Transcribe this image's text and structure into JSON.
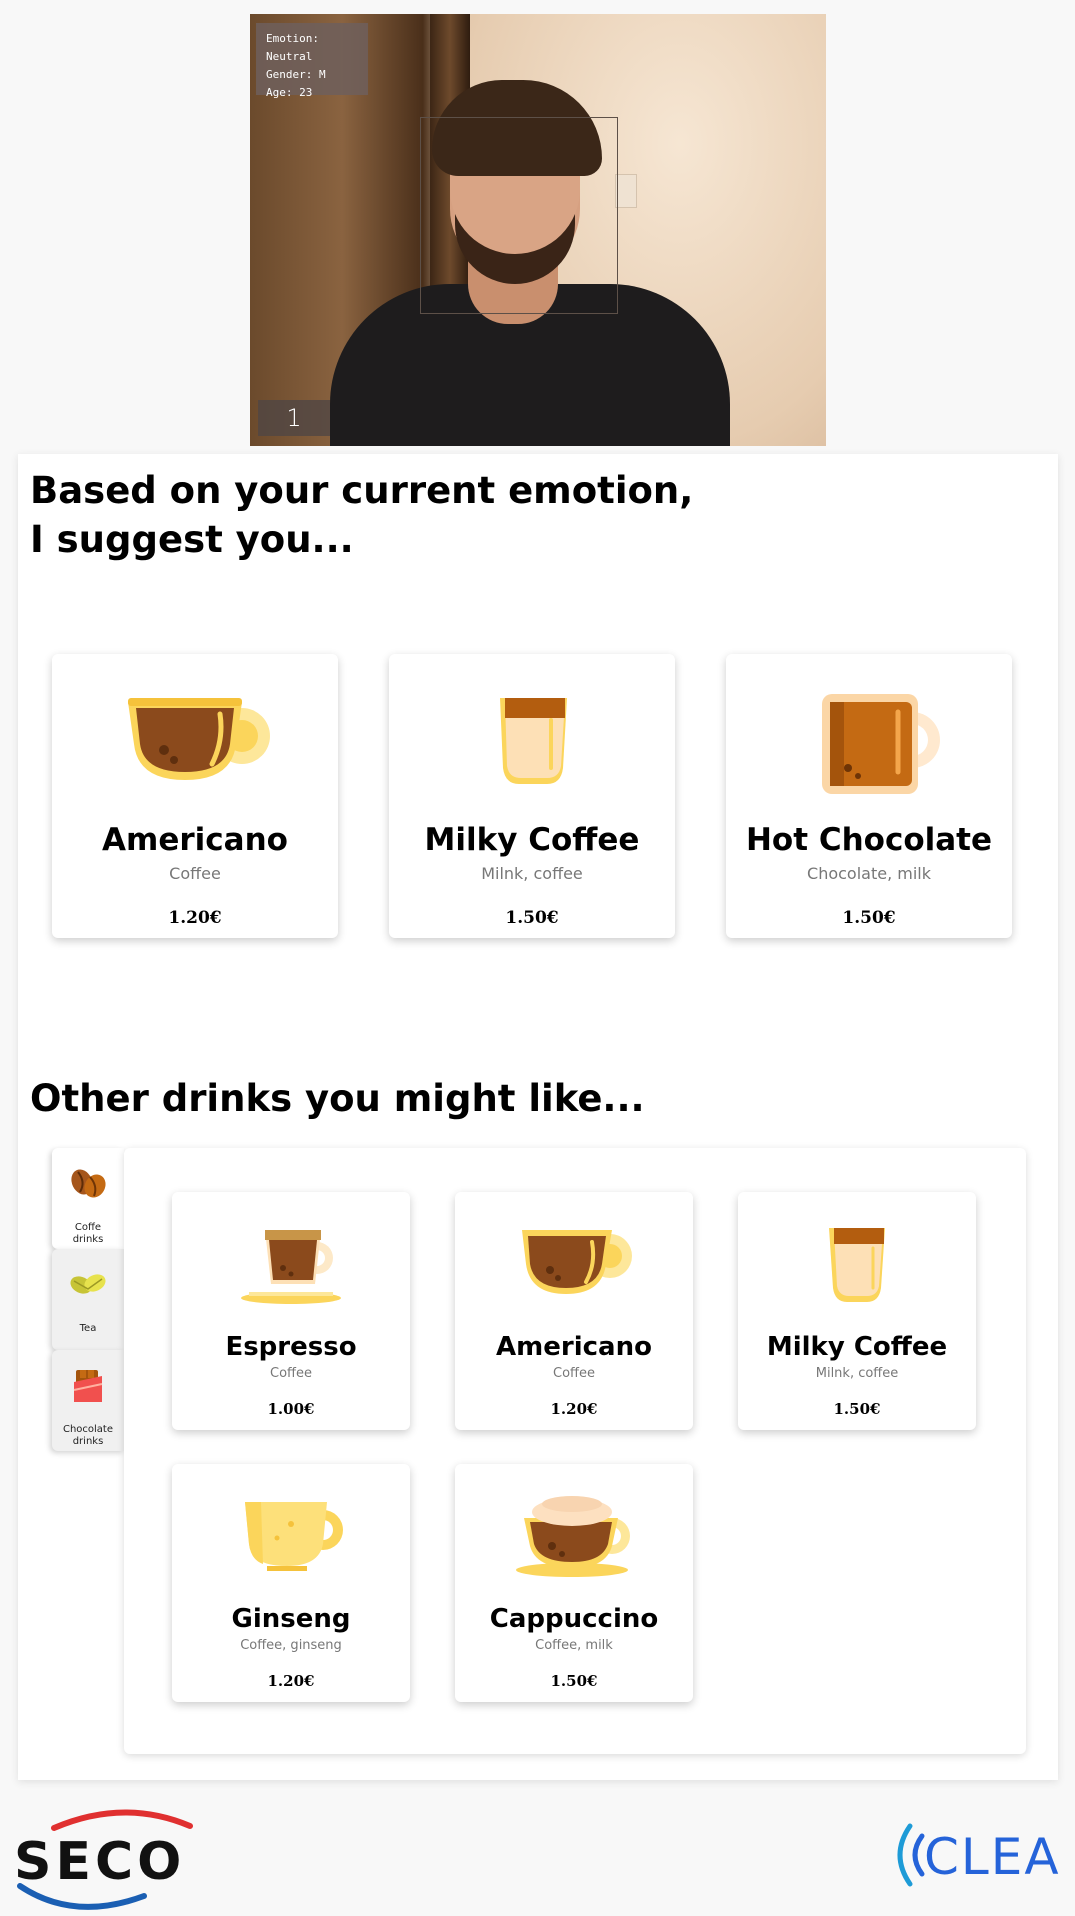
{
  "camera": {
    "info": {
      "emotion": "Emotion: Neutral",
      "gender": "Gender: M",
      "age": "Age: 23"
    },
    "counter": "1"
  },
  "heading": {
    "line1": "Based on your current emotion,",
    "line2": "I suggest you..."
  },
  "suggestions": [
    {
      "name": "Americano",
      "ingredients": "Coffee",
      "price": "1.20€",
      "icon": "americano-cup-icon"
    },
    {
      "name": "Milky Coffee",
      "ingredients": "Milnk, coffee",
      "price": "1.50€",
      "icon": "milky-coffee-glass-icon"
    },
    {
      "name": "Hot Chocolate",
      "ingredients": "Chocolate, milk",
      "price": "1.50€",
      "icon": "hot-chocolate-mug-icon"
    }
  ],
  "other_heading": "Other drinks you might like...",
  "categories": [
    {
      "label_line1": "Coffe",
      "label_line2": "drinks",
      "icon": "coffee-beans-icon"
    },
    {
      "label_line1": "Tea",
      "label_line2": "",
      "icon": "tea-leaves-icon"
    },
    {
      "label_line1": "Chocolate",
      "label_line2": "drinks",
      "icon": "chocolate-bar-icon"
    }
  ],
  "others": [
    {
      "name": "Espresso",
      "ingredients": "Coffee",
      "price": "1.00€",
      "icon": "espresso-cup-icon"
    },
    {
      "name": "Americano",
      "ingredients": "Coffee",
      "price": "1.20€",
      "icon": "americano-cup-icon"
    },
    {
      "name": "Milky Coffee",
      "ingredients": "Milnk, coffee",
      "price": "1.50€",
      "icon": "milky-coffee-glass-icon"
    },
    {
      "name": "Ginseng",
      "ingredients": "Coffee, ginseng",
      "price": "1.20€",
      "icon": "ginseng-cup-icon"
    },
    {
      "name": "Cappuccino",
      "ingredients": "Coffee, milk",
      "price": "1.50€",
      "icon": "cappuccino-cup-icon"
    }
  ],
  "logos": {
    "left": "SECO",
    "right": "CLEA"
  },
  "colors": {
    "cup_yellow": "#fbd55b",
    "coffee_brown": "#8b4a1c",
    "chocolate": "#c46a13",
    "clea_blue": "#2563d9",
    "seco_red": "#e03030"
  }
}
